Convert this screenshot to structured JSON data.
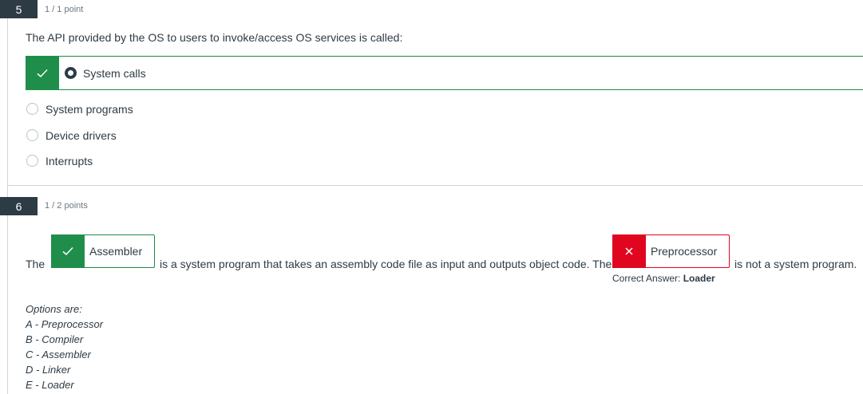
{
  "q5": {
    "number": "5",
    "points": "1 / 1 point",
    "text": "The API provided by the OS to users to invoke/access OS services is called:",
    "selected_option": "System calls",
    "options": [
      "System programs",
      "Device drivers",
      "Interrupts"
    ]
  },
  "q6": {
    "number": "6",
    "points": "1 / 2 points",
    "text_the_1": "The",
    "blank1_answer": "Assembler",
    "text_middle": "is a system program that takes an assembly code file as input and outputs object code.  The",
    "blank2_answer": "Preprocessor",
    "text_end": "is not a system program.",
    "correct_answer_label": "Correct Answer:",
    "correct_answer_value": "Loader",
    "options_header": "Options are:",
    "options": [
      "A - Preprocessor",
      "B - Compiler",
      "C - Assembler",
      "D - Linker",
      "E - Loader"
    ]
  },
  "colors": {
    "correct": "#1f8e4a",
    "incorrect": "#e0061f",
    "badge": "#2d3b45"
  },
  "icons": {
    "check": "check-icon",
    "cross": "close-icon"
  }
}
